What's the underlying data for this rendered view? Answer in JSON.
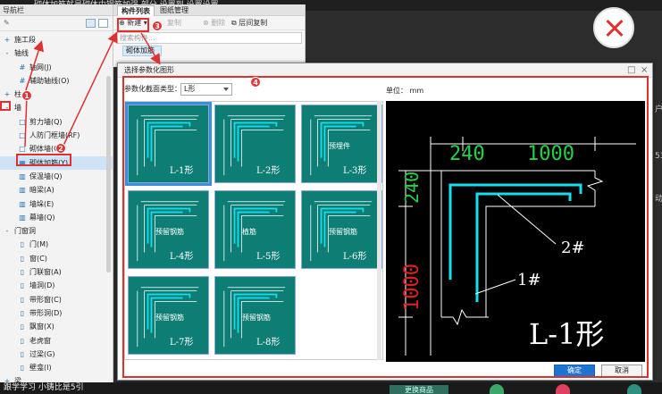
{
  "background": {
    "top_text": "砌体加筋就是砌体中钢筋加强 部分 设置到 设置设置",
    "bottom_text": "跟学学习 小铸比是5引",
    "bottom_button": "更换商品",
    "right_fragments": [
      "户",
      "53",
      "动"
    ]
  },
  "left_panel": {
    "title": "导航栏",
    "tree": [
      {
        "icon": "+",
        "label": "施工段",
        "indent": 0
      },
      {
        "icon": "-",
        "label": "轴线",
        "indent": 0
      },
      {
        "icon": "#",
        "label": "轴网(J)",
        "indent": 1
      },
      {
        "icon": "#",
        "label": "辅助轴线(O)",
        "indent": 1
      },
      {
        "icon": "+",
        "label": "柱",
        "indent": 0
      },
      {
        "icon": "-",
        "label": "墙",
        "indent": 0
      },
      {
        "icon": "□",
        "label": "剪力墙(Q)",
        "indent": 1
      },
      {
        "icon": "□",
        "label": "人防门框墙(RF)",
        "indent": 1
      },
      {
        "icon": "□",
        "label": "砌体墙(Q)",
        "indent": 1
      },
      {
        "icon": "▦",
        "label": "砌体加筋(Y)",
        "indent": 1
      },
      {
        "icon": "▥",
        "label": "保温墙(Q)",
        "indent": 1
      },
      {
        "icon": "▥",
        "label": "暗梁(A)",
        "indent": 1
      },
      {
        "icon": "▥",
        "label": "墙垛(E)",
        "indent": 1
      },
      {
        "icon": "▥",
        "label": "幕墙(Q)",
        "indent": 1
      },
      {
        "icon": "-",
        "label": "门窗洞",
        "indent": 0
      },
      {
        "icon": "▯",
        "label": "门(M)",
        "indent": 1
      },
      {
        "icon": "▯",
        "label": "窗(C)",
        "indent": 1
      },
      {
        "icon": "▯",
        "label": "门联窗(A)",
        "indent": 1
      },
      {
        "icon": "▯",
        "label": "墙洞(D)",
        "indent": 1
      },
      {
        "icon": "▯",
        "label": "带形窗(C)",
        "indent": 1
      },
      {
        "icon": "▯",
        "label": "带形洞(D)",
        "indent": 1
      },
      {
        "icon": "▯",
        "label": "飘窗(X)",
        "indent": 1
      },
      {
        "icon": "▯",
        "label": "老虎窗",
        "indent": 1
      },
      {
        "icon": "▯",
        "label": "过梁(G)",
        "indent": 1
      },
      {
        "icon": "▯",
        "label": "壁龛(I)",
        "indent": 1
      },
      {
        "icon": "+",
        "label": "梁",
        "indent": 0
      }
    ]
  },
  "mid_panel": {
    "tabs": [
      "构件列表",
      "图纸管理"
    ],
    "new_label": "新建",
    "copy_label": "复制",
    "delete_label": "删除",
    "layer_copy_label": "层间复制",
    "search_placeholder": "搜索构件...",
    "item": "砌体加筋"
  },
  "dialog": {
    "title": "选择参数化图形",
    "type_label": "参数化截面类型：",
    "type_value": "L形",
    "unit_label": "单位：",
    "unit_value": "mm",
    "ok": "确定",
    "cancel": "取消",
    "thumbs": [
      {
        "label": "L-1形",
        "sub": ""
      },
      {
        "label": "L-2形",
        "sub": ""
      },
      {
        "label": "L-3形",
        "sub": "预埋件"
      },
      {
        "label": "L-4形",
        "sub": "预留钢筋"
      },
      {
        "label": "L-5形",
        "sub": "植筋"
      },
      {
        "label": "L-6形",
        "sub": "预留钢筋"
      },
      {
        "label": "L-7形",
        "sub": "预留钢筋"
      },
      {
        "label": "L-8形",
        "sub": "预留钢筋"
      }
    ],
    "preview": {
      "dim_top_left": "240",
      "dim_top_right": "1000",
      "dim_left_top": "240",
      "dim_left_bottom": "1000",
      "bar2": "2#",
      "bar1": "1#",
      "shape_label": "L-1形",
      "colors": {
        "bar": "#12e0f0",
        "dim_green": "#24d24a",
        "dim_red": "#e02020",
        "line": "#ffffff"
      }
    }
  },
  "steps": [
    "1",
    "2",
    "3",
    "4"
  ]
}
